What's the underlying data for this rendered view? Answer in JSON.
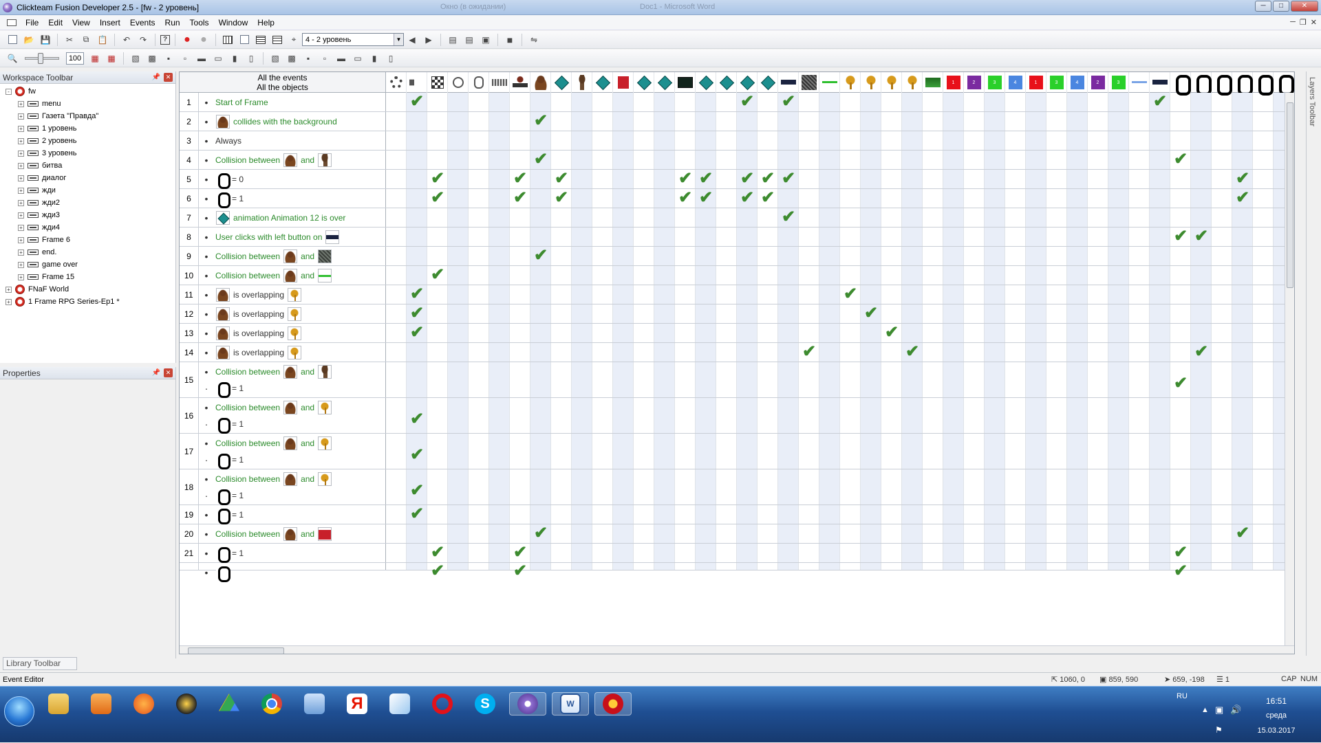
{
  "window": {
    "title": "Clickteam Fusion Developer 2.5 - [fw - 2 уровень]",
    "ghost_title_1": "Окно (в ожидании)",
    "ghost_title_2": "Doc1 - Microsoft Word"
  },
  "menu": [
    "File",
    "Edit",
    "View",
    "Insert",
    "Events",
    "Run",
    "Tools",
    "Window",
    "Help"
  ],
  "toolbar": {
    "frame_select": "4 - 2 уровень",
    "zoom": "100"
  },
  "workspace": {
    "title": "Workspace Toolbar",
    "root": "fw",
    "frames": [
      "menu",
      "Газета \"Правда\"",
      "1 уровень",
      "2 уровень",
      "3 уровень",
      "битва",
      "диалог",
      "жди",
      "жди2",
      "жди3",
      "жди4",
      "Frame 6",
      "end.",
      "game over",
      "Frame 15"
    ],
    "apps": [
      "FNaF World",
      "1 Frame RPG Series-Ep1 *"
    ]
  },
  "properties": {
    "title": "Properties"
  },
  "library": {
    "title": "Library Toolbar"
  },
  "layers": {
    "title": "Layers Toolbar"
  },
  "event_header": {
    "line1": "All the events",
    "line2": "All the objects"
  },
  "object_columns": [
    "gear",
    "speaker",
    "storyboard",
    "timer",
    "mouse",
    "kbd",
    "player",
    "bear",
    "gem",
    "puppet",
    "gem",
    "redbot",
    "gem",
    "gem",
    "dark",
    "gem",
    "gem",
    "gem",
    "gem",
    "bar",
    "stone",
    "lineg",
    "tool",
    "tool",
    "tool",
    "tool",
    "grass",
    "box-red",
    "box-purple",
    "box-green",
    "box-blue",
    "box-red",
    "box-green",
    "box-blue",
    "box-purple",
    "box-green",
    "lineb",
    "bar",
    "digit",
    "digit",
    "digit",
    "digit",
    "digit",
    "digit"
  ],
  "box_labels": {
    "box-red": "1",
    "box-purple": "2",
    "box-green": "3",
    "box-blue": "4"
  },
  "events": [
    {
      "n": "1",
      "h": 1,
      "conds": [
        {
          "t": [
            [
              "g",
              "Start of Frame"
            ]
          ]
        }
      ],
      "checks": [
        1,
        17,
        19,
        37
      ]
    },
    {
      "n": "2",
      "h": 1,
      "conds": [
        {
          "t": [
            [
              "i",
              "bear"
            ],
            [
              "g",
              "collides with the background"
            ]
          ]
        }
      ],
      "checks": [
        7
      ]
    },
    {
      "n": "3",
      "h": 1,
      "conds": [
        {
          "t": [
            [
              "k",
              "Always"
            ]
          ]
        }
      ],
      "checks": []
    },
    {
      "n": "4",
      "h": 1,
      "conds": [
        {
          "t": [
            [
              "g",
              "Collision between"
            ],
            [
              "i",
              "bear"
            ],
            [
              "g",
              "and"
            ],
            [
              "i",
              "puppet"
            ]
          ]
        }
      ],
      "checks": [
        7,
        38
      ]
    },
    {
      "n": "5",
      "h": 1,
      "conds": [
        {
          "t": [
            [
              "i",
              "counter"
            ],
            [
              "k",
              "= 0"
            ]
          ]
        }
      ],
      "checks": [
        2,
        6,
        8,
        14,
        15,
        17,
        18,
        19,
        41
      ]
    },
    {
      "n": "6",
      "h": 1,
      "conds": [
        {
          "t": [
            [
              "i",
              "counter"
            ],
            [
              "k",
              "= 1"
            ]
          ]
        }
      ],
      "checks": [
        2,
        6,
        8,
        14,
        15,
        17,
        18,
        41
      ]
    },
    {
      "n": "7",
      "h": 1,
      "conds": [
        {
          "t": [
            [
              "i",
              "gem"
            ],
            [
              "g",
              "animation Animation 12 is over"
            ]
          ]
        }
      ],
      "checks": [
        19
      ]
    },
    {
      "n": "8",
      "h": 1,
      "conds": [
        {
          "t": [
            [
              "g",
              "User clicks with left button on"
            ],
            [
              "i",
              "bar"
            ]
          ]
        }
      ],
      "checks": [
        38,
        39
      ]
    },
    {
      "n": "9",
      "h": 1,
      "conds": [
        {
          "t": [
            [
              "g",
              "Collision between"
            ],
            [
              "i",
              "bear"
            ],
            [
              "g",
              "and"
            ],
            [
              "i",
              "stone"
            ]
          ]
        }
      ],
      "checks": [
        7
      ]
    },
    {
      "n": "10",
      "h": 1,
      "conds": [
        {
          "t": [
            [
              "g",
              "Collision between"
            ],
            [
              "i",
              "bear"
            ],
            [
              "g",
              "and"
            ],
            [
              "i",
              "lineg"
            ]
          ]
        }
      ],
      "checks": [
        2
      ]
    },
    {
      "n": "11",
      "h": 1,
      "conds": [
        {
          "t": [
            [
              "i",
              "bear"
            ],
            [
              "k",
              "is overlapping"
            ],
            [
              "i",
              "tool"
            ]
          ]
        }
      ],
      "checks": [
        1,
        22
      ]
    },
    {
      "n": "12",
      "h": 1,
      "conds": [
        {
          "t": [
            [
              "i",
              "bear"
            ],
            [
              "k",
              "is overlapping"
            ],
            [
              "i",
              "tool"
            ]
          ]
        }
      ],
      "checks": [
        1,
        23
      ]
    },
    {
      "n": "13",
      "h": 1,
      "conds": [
        {
          "t": [
            [
              "i",
              "bear"
            ],
            [
              "k",
              "is overlapping"
            ],
            [
              "i",
              "tool"
            ]
          ]
        }
      ],
      "checks": [
        1,
        24
      ]
    },
    {
      "n": "14",
      "h": 1,
      "conds": [
        {
          "t": [
            [
              "i",
              "bear"
            ],
            [
              "k",
              "is overlapping"
            ],
            [
              "i",
              "tool"
            ]
          ]
        }
      ],
      "checks": [
        20,
        25,
        39
      ]
    },
    {
      "n": "15",
      "h": 2,
      "conds": [
        {
          "t": [
            [
              "g",
              "Collision between"
            ],
            [
              "i",
              "bear"
            ],
            [
              "g",
              "and"
            ],
            [
              "i",
              "puppet"
            ]
          ]
        },
        {
          "t": [
            [
              "i",
              "counter"
            ],
            [
              "k",
              "= 1"
            ]
          ]
        }
      ],
      "checks": [
        38
      ]
    },
    {
      "n": "16",
      "h": 2,
      "conds": [
        {
          "t": [
            [
              "g",
              "Collision between"
            ],
            [
              "i",
              "bear"
            ],
            [
              "g",
              "and"
            ],
            [
              "i",
              "tool"
            ]
          ]
        },
        {
          "t": [
            [
              "i",
              "counter"
            ],
            [
              "k",
              "= 1"
            ]
          ]
        }
      ],
      "checks": [
        1
      ]
    },
    {
      "n": "17",
      "h": 2,
      "conds": [
        {
          "t": [
            [
              "g",
              "Collision between"
            ],
            [
              "i",
              "bear"
            ],
            [
              "g",
              "and"
            ],
            [
              "i",
              "tool"
            ]
          ]
        },
        {
          "t": [
            [
              "i",
              "counter"
            ],
            [
              "k",
              "= 1"
            ]
          ]
        }
      ],
      "checks": [
        1
      ]
    },
    {
      "n": "18",
      "h": 2,
      "conds": [
        {
          "t": [
            [
              "g",
              "Collision between"
            ],
            [
              "i",
              "bear"
            ],
            [
              "g",
              "and"
            ],
            [
              "i",
              "tool"
            ]
          ]
        },
        {
          "t": [
            [
              "i",
              "counter"
            ],
            [
              "k",
              "= 1"
            ]
          ]
        }
      ],
      "checks": [
        1
      ]
    },
    {
      "n": "19",
      "h": 1,
      "conds": [
        {
          "t": [
            [
              "i",
              "counter"
            ],
            [
              "k",
              "= 1"
            ]
          ]
        }
      ],
      "checks": [
        1
      ]
    },
    {
      "n": "20",
      "h": 1,
      "conds": [
        {
          "t": [
            [
              "g",
              "Collision between"
            ],
            [
              "i",
              "bear"
            ],
            [
              "g",
              "and"
            ],
            [
              "i",
              "redbot"
            ]
          ]
        }
      ],
      "checks": [
        7,
        41
      ]
    },
    {
      "n": "21",
      "h": 1,
      "conds": [
        {
          "t": [
            [
              "i",
              "counter"
            ],
            [
              "k",
              "= 1"
            ]
          ]
        }
      ],
      "checks": [
        2,
        6,
        38
      ]
    },
    {
      "n": "",
      "h": 0.4,
      "conds": [
        {
          "t": [
            [
              "i",
              "counter"
            ]
          ]
        }
      ],
      "checks": [
        2,
        6,
        38
      ]
    }
  ],
  "status": {
    "left": "Event Editor",
    "coords1": "1060, 0",
    "coords2": "859, 590",
    "coords3": "659, -198",
    "layer": "1",
    "cap": "CAP",
    "num": "NUM"
  },
  "tray": {
    "lang": "RU",
    "time": "16:51",
    "day": "среда",
    "date": "15.03.2017"
  }
}
